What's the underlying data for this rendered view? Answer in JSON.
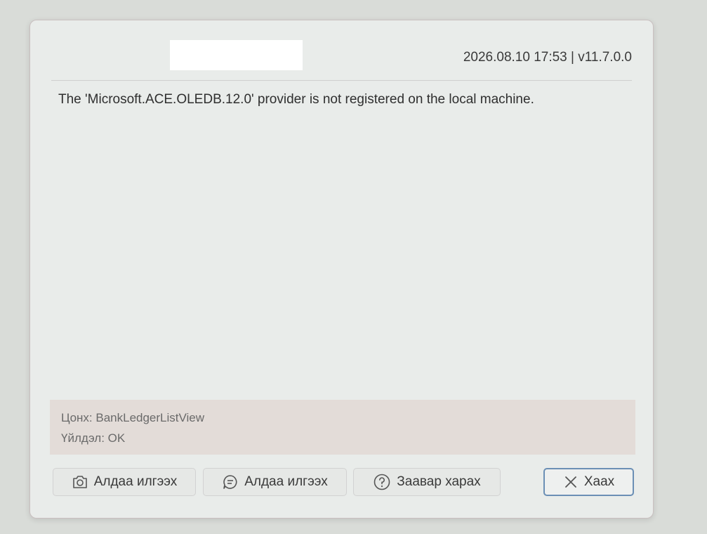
{
  "header": {
    "timestamp_version": "2026.08.10 17:53 | v11.7.0.0"
  },
  "error": {
    "message": "The 'Microsoft.ACE.OLEDB.12.0' provider is not registered on the local machine."
  },
  "details": {
    "window_line": "Цонх: BankLedgerListView",
    "action_line": "Үйлдэл: OK"
  },
  "buttons": {
    "screenshot_label": "Алдаа илгээх",
    "send_error_label": "Алдаа илгээх",
    "help_label": "Заавар харах",
    "close_label": "Хаах"
  },
  "icons": {
    "screenshot": "camera-icon",
    "send_error": "message-icon",
    "help": "help-icon",
    "close": "close-icon"
  },
  "colors": {
    "close_border": "#6b8fb5"
  }
}
